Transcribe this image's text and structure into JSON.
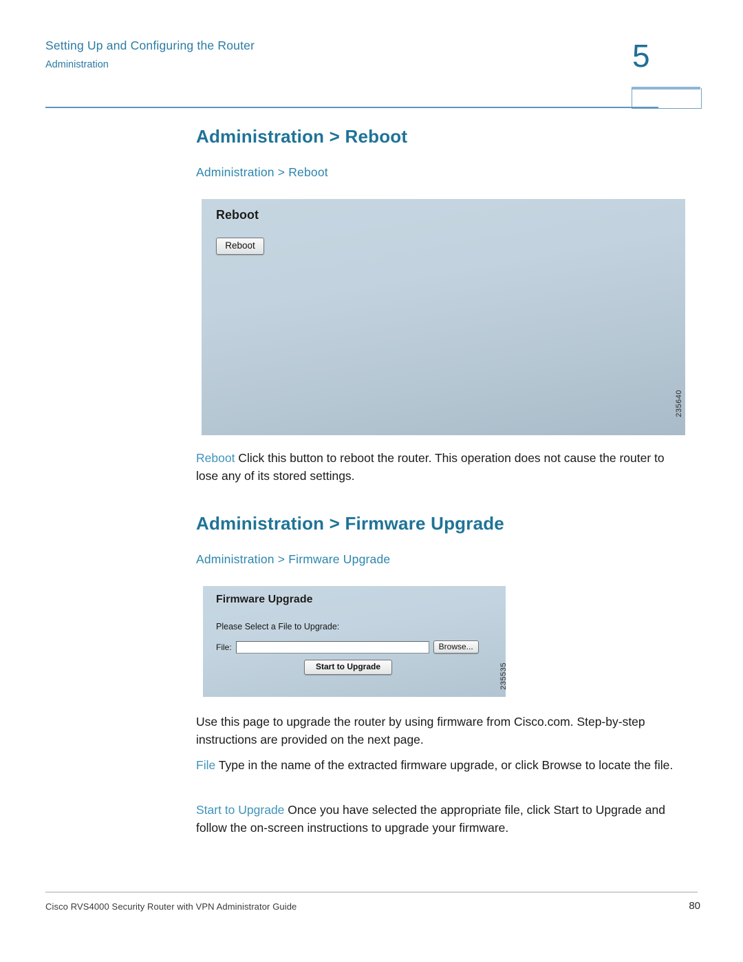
{
  "header": {
    "title": "Setting Up and Configuring the Router",
    "subtitle": "Administration",
    "chapter_number": "5"
  },
  "sections": [
    {
      "heading": "Administration > Reboot",
      "subheading": "Administration > Reboot",
      "figure": {
        "panel_title": "Reboot",
        "button_label": "Reboot",
        "figure_number": "235640"
      },
      "paragraphs": [
        {
          "term": "Reboot",
          "text": " Click this button to reboot the router. This operation does not cause the router to lose any of its stored settings."
        }
      ]
    },
    {
      "heading": "Administration > Firmware Upgrade",
      "subheading": "Administration > Firmware Upgrade",
      "figure": {
        "panel_title": "Firmware Upgrade",
        "prompt": "Please Select a File to Upgrade:",
        "file_label": "File:",
        "file_value": "",
        "browse_label": "Browse...",
        "start_label": "Start to Upgrade",
        "figure_number": "235535"
      },
      "paragraphs": [
        {
          "term": "",
          "text": "Use this page to upgrade the router by using firmware from Cisco.com. Step-by-step instructions are provided on the next page."
        },
        {
          "term": "File",
          "text": " Type in the name of the extracted firmware upgrade, or click Browse to locate the file."
        },
        {
          "term": "Start to Upgrade",
          "text": " Once you have selected the appropriate file, click Start to Upgrade and follow the on-screen instructions to upgrade your firmware."
        }
      ]
    }
  ],
  "footer": {
    "text": "Cisco RVS4000 Security Router with VPN Administrator Guide",
    "page_number": "80"
  },
  "colors": {
    "accent_blue": "#1f7397",
    "heading_blue": "#2b86ad",
    "rule_blue": "#5f95bf",
    "panel_top": "#c6d6e1",
    "panel_bottom": "#a9bac8"
  }
}
